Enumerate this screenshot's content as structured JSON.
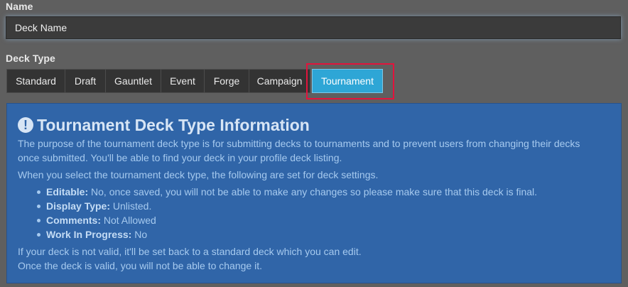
{
  "form": {
    "name_label": "Name",
    "name_value": "Deck Name",
    "deck_type_label": "Deck Type"
  },
  "deck_types": [
    {
      "label": "Standard",
      "active": false
    },
    {
      "label": "Draft",
      "active": false
    },
    {
      "label": "Gauntlet",
      "active": false
    },
    {
      "label": "Event",
      "active": false
    },
    {
      "label": "Forge",
      "active": false
    },
    {
      "label": "Campaign",
      "active": false
    },
    {
      "label": "Tournament",
      "active": true
    }
  ],
  "info": {
    "icon": "exclamation-circle-icon",
    "icon_glyph": "!",
    "title": "Tournament Deck Type Information",
    "intro": "The purpose of the tournament deck type is for submitting decks to tournaments and to prevent users from changing their decks once submitted. You'll be able to find your deck in your profile deck listing.",
    "settings_intro": "When you select the tournament deck type, the following are set for deck settings.",
    "settings": [
      {
        "key": "Editable:",
        "value": " No, once saved, you will not be able to make any changes so please make sure that this deck is final."
      },
      {
        "key": "Display Type:",
        "value": " Unlisted."
      },
      {
        "key": "Comments:",
        "value": " Not Allowed"
      },
      {
        "key": "Work In Progress:",
        "value": " No"
      }
    ],
    "footer_1": "If your deck is not valid, it'll be set back to a standard deck which you can edit.",
    "footer_2": "Once the deck is valid, you will not be able to change it."
  },
  "colors": {
    "page_bg": "#5f5f5f",
    "input_bg": "#3b3b3b",
    "button_bg": "#333333",
    "active_button": "#2ea6d6",
    "panel_bg": "#3065a8",
    "highlight": "#e2143c"
  }
}
